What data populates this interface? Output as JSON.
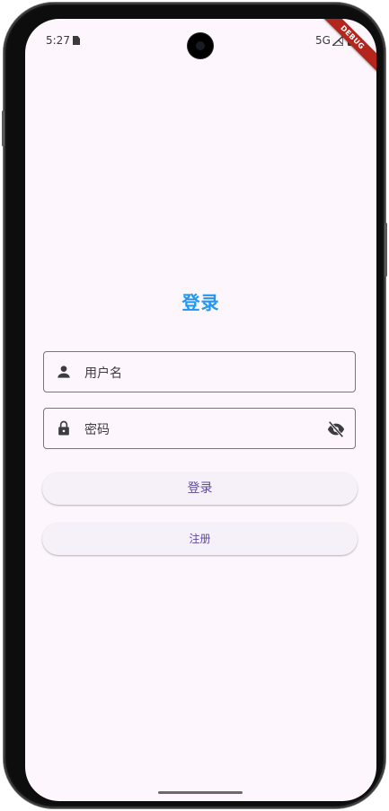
{
  "status_bar": {
    "time": "5:27",
    "network": "5G",
    "icons": [
      "sim-card-icon",
      "signal-icon",
      "battery-icon"
    ]
  },
  "debug_banner": "DEBUG",
  "login_page": {
    "title": "登录",
    "username": {
      "label": "用户名",
      "icon": "person-icon"
    },
    "password": {
      "label": "密码",
      "icon": "lock-icon",
      "trailing_icon": "visibility-off-icon"
    },
    "login_button": "登录",
    "register_button": "注册"
  },
  "colors": {
    "accent_title": "#2196f3",
    "button_text": "#5b4aa0",
    "background": "#fdf6fd",
    "outline": "#79747e",
    "debug_ribbon": "#b3261e"
  }
}
